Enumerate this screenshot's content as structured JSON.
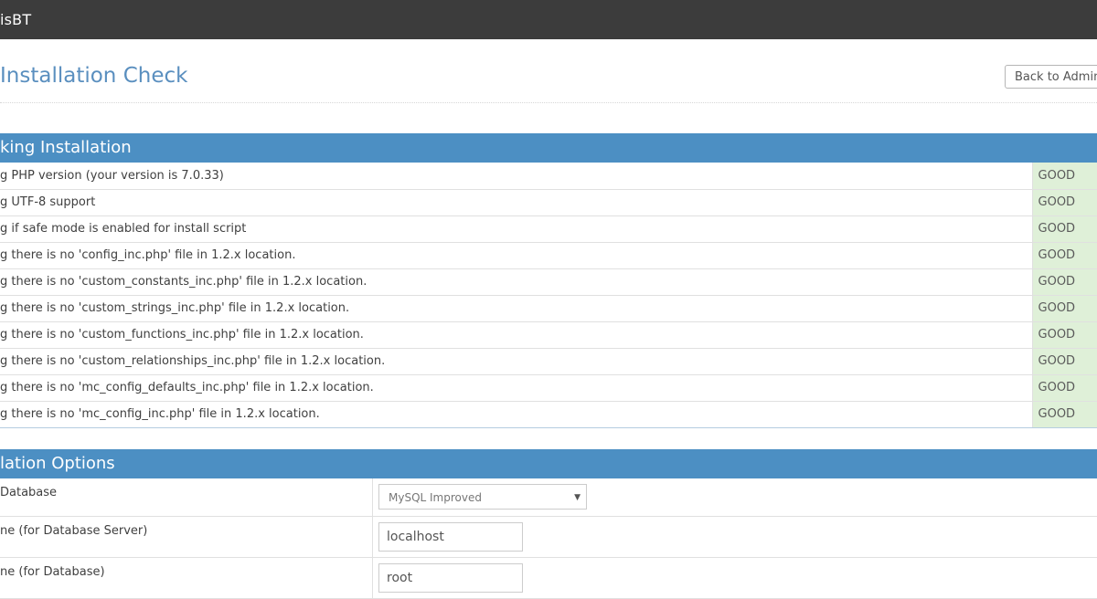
{
  "header": {
    "brand": "isBT"
  },
  "page": {
    "title": "Installation Check",
    "back_button": "Back to Admini"
  },
  "checking_section": {
    "title": "king Installation",
    "rows": [
      {
        "label": "g PHP version (your version is 7.0.33)",
        "status": "GOOD"
      },
      {
        "label": "g UTF-8 support",
        "status": "GOOD"
      },
      {
        "label": "g if safe mode is enabled for install script",
        "status": "GOOD"
      },
      {
        "label": "g there is no 'config_inc.php' file in 1.2.x location.",
        "status": "GOOD"
      },
      {
        "label": "g there is no 'custom_constants_inc.php' file in 1.2.x location.",
        "status": "GOOD"
      },
      {
        "label": "g there is no 'custom_strings_inc.php' file in 1.2.x location.",
        "status": "GOOD"
      },
      {
        "label": "g there is no 'custom_functions_inc.php' file in 1.2.x location.",
        "status": "GOOD"
      },
      {
        "label": "g there is no 'custom_relationships_inc.php' file in 1.2.x location.",
        "status": "GOOD"
      },
      {
        "label": "g there is no 'mc_config_defaults_inc.php' file in 1.2.x location.",
        "status": "GOOD"
      },
      {
        "label": "g there is no 'mc_config_inc.php' file in 1.2.x location.",
        "status": "GOOD"
      }
    ]
  },
  "options_section": {
    "title": "lation Options",
    "rows": [
      {
        "label": "Database",
        "control": "select",
        "value": "MySQL Improved"
      },
      {
        "label": "ne (for Database Server)",
        "control": "input",
        "value": "localhost"
      },
      {
        "label": "ne (for Database)",
        "control": "input",
        "value": "root"
      }
    ]
  }
}
